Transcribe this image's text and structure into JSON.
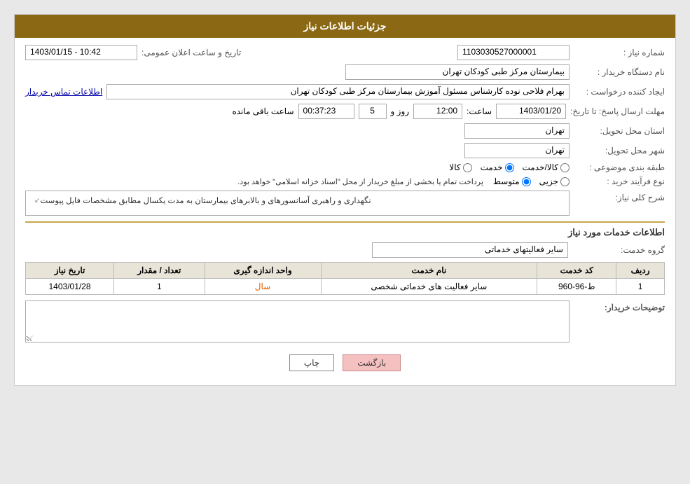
{
  "header": {
    "title": "جزئیات اطلاعات نیاز"
  },
  "fields": {
    "need_number_label": "شماره نیاز :",
    "need_number_value": "1103030527000001",
    "buyer_org_label": "نام دستگاه خریدار :",
    "buyer_org_value": "بیمارستان مرکز طبی کودکان تهران",
    "creator_label": "ایجاد کننده درخواست :",
    "creator_value": "بهرام فلاحی نوده کارشناس مسئول آموزش بیمارستان مرکز طبی کودکان تهران",
    "creator_link": "اطلاعات تماس خریدار",
    "send_deadline_label": "مهلت ارسال پاسخ: تا تاریخ:",
    "date_value": "1403/01/20",
    "time_label": "ساعت:",
    "time_value": "12:00",
    "days_label": "روز و",
    "days_value": "5",
    "remaining_label": "ساعت باقی مانده",
    "remaining_value": "00:37:23",
    "announce_date_label": "تاریخ و ساعت اعلان عمومی:",
    "announce_date_value": "1403/01/15 - 10:42",
    "delivery_province_label": "استان محل تحویل:",
    "delivery_province_value": "تهران",
    "delivery_city_label": "شهر محل تحویل:",
    "delivery_city_value": "تهران",
    "category_label": "طبقه بندی موضوعی :",
    "category_options": [
      {
        "id": "kala",
        "label": "کالا"
      },
      {
        "id": "khadamat",
        "label": "خدمت"
      },
      {
        "id": "kala_khadamat",
        "label": "کالا/خدمت"
      }
    ],
    "category_selected": "khadamat",
    "purchase_type_label": "نوع فرآیند خرید :",
    "purchase_options": [
      {
        "id": "jozi",
        "label": "جزیی"
      },
      {
        "id": "motavasset",
        "label": "متوسط"
      },
      {
        "id": "other",
        "label": ""
      }
    ],
    "purchase_note": "پرداخت تمام یا بخشی از مبلغ خریدار از محل \"اسناد خزانه اسلامی\" خواهد بود.",
    "need_description_label": "شرح کلی نیاز:",
    "need_description_value": "نگهداری و راهبری آسانسورهای و بالابرهای بیمارستان به مدت یکسال مطابق مشخصات فایل پیوست"
  },
  "services_section": {
    "title": "اطلاعات خدمات مورد نیاز",
    "service_group_label": "گروه خدمت:",
    "service_group_value": "سایر فعالیتهای خدماتی",
    "table_headers": [
      "ردیف",
      "کد خدمت",
      "نام خدمت",
      "واحد اندازه گیری",
      "تعداد / مقدار",
      "تاریخ نیاز"
    ],
    "table_rows": [
      {
        "row": "1",
        "code": "ط-96-960",
        "name": "سایر فعالیت های خدماتی شخصی",
        "unit": "سال",
        "quantity": "1",
        "date": "1403/01/28"
      }
    ]
  },
  "buyer_notes_label": "توضیحات خریدار:",
  "buyer_notes_value": "",
  "buttons": {
    "print": "چاپ",
    "back": "بازگشت"
  }
}
